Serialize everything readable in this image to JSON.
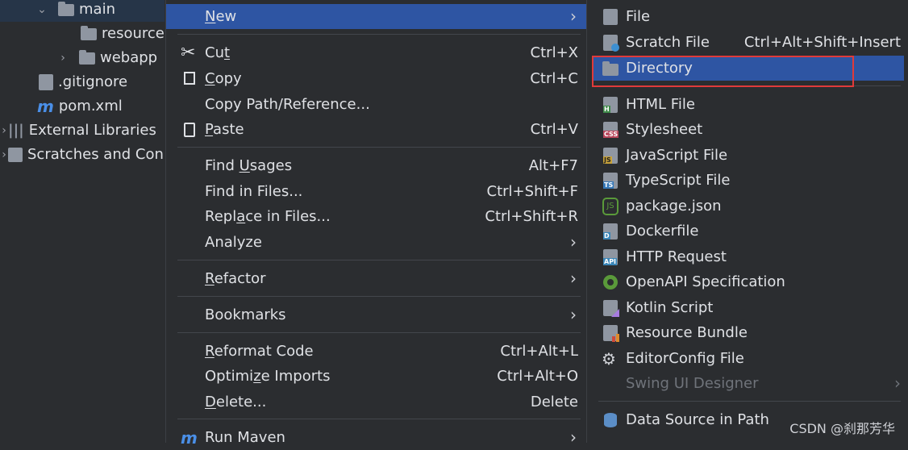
{
  "tree": {
    "items": [
      {
        "label": "main",
        "icon": "folder-icon"
      },
      {
        "label": "resources",
        "icon": "resources-folder-icon"
      },
      {
        "label": "webapp",
        "icon": "web-folder-icon"
      },
      {
        "label": ".gitignore",
        "icon": "gitignore-file-icon"
      },
      {
        "label": "pom.xml",
        "icon": "maven-icon"
      },
      {
        "label": "External Libraries",
        "icon": "libraries-icon"
      },
      {
        "label": "Scratches and Con",
        "icon": "scratches-icon"
      }
    ]
  },
  "context_menu": {
    "new": {
      "label_u": "N",
      "label_rest": "ew"
    },
    "cut": {
      "pre": "Cu",
      "u": "t",
      "post": "",
      "shortcut": "Ctrl+X"
    },
    "copy": {
      "pre": "",
      "u": "C",
      "post": "opy",
      "shortcut": "Ctrl+C"
    },
    "copy_path": {
      "label": "Copy Path/Reference..."
    },
    "paste": {
      "pre": "",
      "u": "P",
      "post": "aste",
      "shortcut": "Ctrl+V"
    },
    "find_usages": {
      "pre": "Find ",
      "u": "U",
      "post": "sages",
      "shortcut": "Alt+F7"
    },
    "find_in_files": {
      "label": "Find in Files...",
      "shortcut": "Ctrl+Shift+F"
    },
    "replace_in_files": {
      "pre": "Repl",
      "u": "a",
      "post": "ce in Files...",
      "shortcut": "Ctrl+Shift+R"
    },
    "analyze": {
      "label": "Analyze"
    },
    "refactor": {
      "pre": "",
      "u": "R",
      "post": "efactor"
    },
    "bookmarks": {
      "label": "Bookmarks"
    },
    "reformat": {
      "pre": "",
      "u": "R",
      "post": "eformat Code",
      "shortcut": "Ctrl+Alt+L"
    },
    "optimize": {
      "pre": "Optimi",
      "u": "z",
      "post": "e Imports",
      "shortcut": "Ctrl+Alt+O"
    },
    "delete": {
      "pre": "",
      "u": "D",
      "post": "elete...",
      "shortcut": "Delete"
    },
    "run_maven": {
      "label": "Run Maven"
    }
  },
  "submenu": {
    "items": [
      {
        "label": "File",
        "icon": "file-icon",
        "shortcut": ""
      },
      {
        "label": "Scratch File",
        "icon": "scratch-file-icon",
        "shortcut": "Ctrl+Alt+Shift+Insert"
      },
      {
        "label": "Directory",
        "icon": "directory-icon",
        "shortcut": ""
      },
      {
        "label": "HTML File",
        "icon": "html-file-icon",
        "tag": "H"
      },
      {
        "label": "Stylesheet",
        "icon": "css-file-icon",
        "tag": "CSS"
      },
      {
        "label": "JavaScript File",
        "icon": "js-file-icon",
        "tag": "JS"
      },
      {
        "label": "TypeScript File",
        "icon": "ts-file-icon",
        "tag": "TS"
      },
      {
        "label": "package.json",
        "icon": "nodejs-icon"
      },
      {
        "label": "Dockerfile",
        "icon": "dockerfile-icon",
        "tag": "D"
      },
      {
        "label": "HTTP Request",
        "icon": "http-request-icon",
        "tag": "API"
      },
      {
        "label": "OpenAPI Specification",
        "icon": "openapi-icon"
      },
      {
        "label": "Kotlin Script",
        "icon": "kotlin-script-icon"
      },
      {
        "label": "Resource Bundle",
        "icon": "resource-bundle-icon"
      },
      {
        "label": "EditorConfig File",
        "icon": "gear-icon"
      },
      {
        "label": "Swing UI Designer",
        "icon": "",
        "disabled": true
      },
      {
        "label": "Data Source in Path",
        "icon": "database-icon"
      }
    ]
  },
  "watermark": "CSDN @刹那芳华",
  "colors": {
    "highlight": "#2e55a3",
    "annotation_box": "#e03a3a",
    "background": "#2b2d30"
  }
}
